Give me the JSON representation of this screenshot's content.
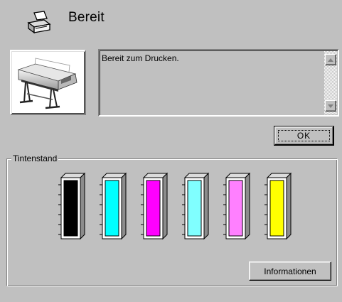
{
  "header": {
    "status_title": "Bereit",
    "status_icon": "printer-icon"
  },
  "printer_picture": {
    "icon": "large-format-printer-icon"
  },
  "message": {
    "text": "Bereit zum Drucken."
  },
  "buttons": {
    "ok_label": "OK",
    "info_label": "Informationen"
  },
  "ink_section": {
    "legend": "Tintenstand",
    "cartridges": [
      {
        "name": "black",
        "color": "#000000",
        "level": 1.0
      },
      {
        "name": "cyan",
        "color": "#00ffff",
        "level": 1.0
      },
      {
        "name": "magenta",
        "color": "#ff00ff",
        "level": 1.0
      },
      {
        "name": "light-cyan",
        "color": "#80ffff",
        "level": 1.0
      },
      {
        "name": "light-magenta",
        "color": "#ff80ff",
        "level": 1.0
      },
      {
        "name": "yellow",
        "color": "#ffff00",
        "level": 1.0
      }
    ]
  }
}
